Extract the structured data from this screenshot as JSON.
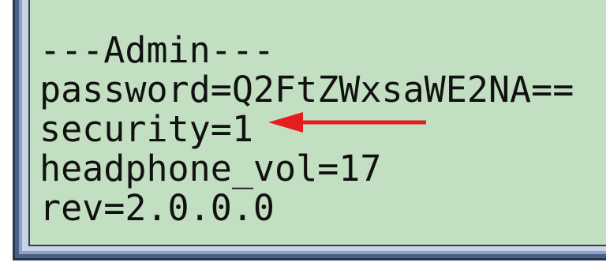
{
  "config_text": {
    "lines": [
      "---Admin---",
      "password=Q2FtZWxsaWE2NA==",
      "security=1",
      "headphone_vol=17",
      "rev=2.0.0.0"
    ]
  },
  "annotation": {
    "arrow_color": "#e61d1d",
    "arrow_target": "security-line"
  },
  "colors": {
    "background": "#c2dfc2",
    "frame": "#4a5e88",
    "text": "#111111"
  }
}
